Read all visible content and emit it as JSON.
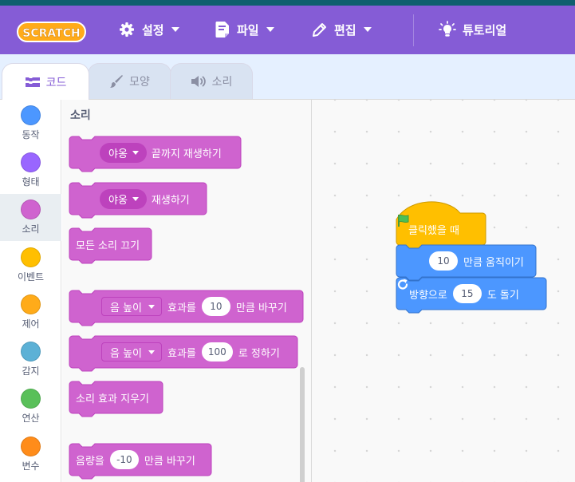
{
  "menubar": {
    "logo_text": "SCRATCH",
    "settings": "설정",
    "file": "파일",
    "edit": "편집",
    "tutorials": "튜토리얼"
  },
  "tabs": {
    "code": "코드",
    "costumes": "모양",
    "sounds": "소리"
  },
  "categories": [
    {
      "label": "동작",
      "color": "#4c97ff"
    },
    {
      "label": "형태",
      "color": "#9966ff"
    },
    {
      "label": "소리",
      "color": "#cf63cf"
    },
    {
      "label": "이벤트",
      "color": "#ffbf00"
    },
    {
      "label": "제어",
      "color": "#ffab19"
    },
    {
      "label": "감지",
      "color": "#5cb1d6"
    },
    {
      "label": "연산",
      "color": "#59c059"
    },
    {
      "label": "변수",
      "color": "#ff8c1a"
    }
  ],
  "palette": {
    "title": "소리",
    "play_until_done": {
      "sound": "야옹",
      "text": "끝까지 재생하기"
    },
    "start_sound": {
      "sound": "야옹",
      "text": "재생하기"
    },
    "stop_all": "모든 소리 끄기",
    "change_effect": {
      "effect": "음 높이",
      "text1": "효과를",
      "value": "10",
      "text2": "만큼 바꾸기"
    },
    "set_effect": {
      "effect": "음 높이",
      "text1": "효과를",
      "value": "100",
      "text2": "로 정하기"
    },
    "clear_effects": "소리 효과 지우기",
    "change_volume": {
      "text1": "음량을",
      "value": "-10",
      "text2": "만큼 바꾸기"
    }
  },
  "script": {
    "hat": "클릭했을 때",
    "move": {
      "value": "10",
      "text": "만큼 움직이기"
    },
    "turn": {
      "text1": "방향으로",
      "value": "15",
      "text2": "도 돌기"
    }
  },
  "colors": {
    "menubar": "#855cd6",
    "sound_block": "#cf63cf",
    "sound_block_dark": "#bd42bd",
    "event_block": "#ffbf00",
    "motion_block": "#4c97ff"
  }
}
